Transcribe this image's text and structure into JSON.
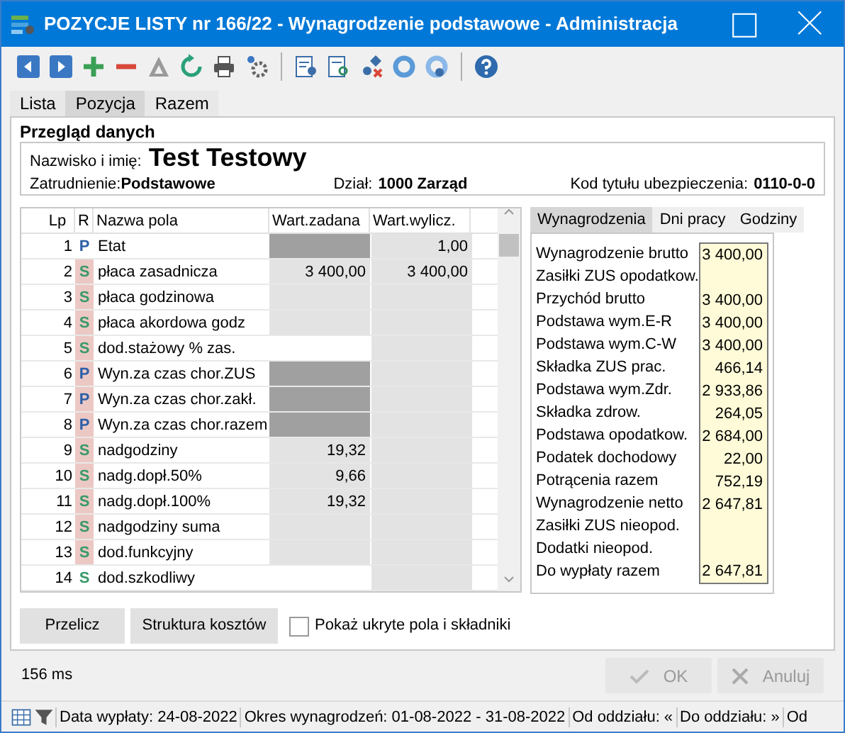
{
  "window": {
    "title": "POZYCJE LISTY nr 166/22 - Wynagrodzenie podstawowe - Administracja"
  },
  "tabs": [
    {
      "label": "Lista",
      "selected": false
    },
    {
      "label": "Pozycja",
      "selected": true
    },
    {
      "label": "Razem",
      "selected": false
    }
  ],
  "overview": {
    "title": "Przegląd danych",
    "name_label": "Nazwisko i imię:",
    "name": "Test Testowy",
    "employment_label": "Zatrudnienie:",
    "employment": "Podstawowe",
    "department_label": "Dział:",
    "department": "1000 Zarząd",
    "insurance_label": "Kod tytułu ubezpieczenia:",
    "insurance": "0110-0-0"
  },
  "table": {
    "columns": [
      "Lp",
      "R",
      "Nazwa pola",
      "Wart.zadana",
      "Wart.wylicz."
    ],
    "rows": [
      {
        "lp": "1",
        "r": "P",
        "highlighted": false,
        "name": "Etat",
        "kind": "locked",
        "calc_value": "1,00"
      },
      {
        "lp": "2",
        "r": "S",
        "highlighted": true,
        "name": "płaca zasadnicza",
        "set_value": "3 400,00",
        "kind": "readonly",
        "calc_value": "3 400,00"
      },
      {
        "lp": "3",
        "r": "S",
        "highlighted": true,
        "name": "płaca godzinowa",
        "kind": "readonly"
      },
      {
        "lp": "4",
        "r": "S",
        "highlighted": true,
        "name": "płaca akordowa godz",
        "kind": "readonly"
      },
      {
        "lp": "5",
        "r": "S",
        "highlighted": true,
        "name": "dod.stażowy % zas.",
        "kind": "editable"
      },
      {
        "lp": "6",
        "r": "P",
        "highlighted": true,
        "name": "Wyn.za czas chor.ZUS",
        "kind": "locked"
      },
      {
        "lp": "7",
        "r": "P",
        "highlighted": true,
        "name": "Wyn.za czas chor.zakł.",
        "kind": "locked"
      },
      {
        "lp": "8",
        "r": "P",
        "highlighted": true,
        "name": "Wyn.za czas chor.razem",
        "kind": "locked"
      },
      {
        "lp": "9",
        "r": "S",
        "highlighted": true,
        "name": "nadgodziny",
        "set_value": "19,32",
        "kind": "readonly"
      },
      {
        "lp": "10",
        "r": "S",
        "highlighted": true,
        "name": "nadg.dopł.50%",
        "set_value": "9,66",
        "kind": "readonly"
      },
      {
        "lp": "11",
        "r": "S",
        "highlighted": true,
        "name": "nadg.dopł.100%",
        "set_value": "19,32",
        "kind": "readonly"
      },
      {
        "lp": "12",
        "r": "S",
        "highlighted": true,
        "name": "nadgodziny suma",
        "kind": "readonly"
      },
      {
        "lp": "13",
        "r": "S",
        "highlighted": true,
        "name": "dod.funkcyjny",
        "kind": "readonly"
      },
      {
        "lp": "14",
        "r": "S",
        "highlighted": false,
        "name": "dod.szkodliwy",
        "kind": "editable"
      }
    ]
  },
  "side_tabs": [
    {
      "label": "Wynagrodzenia",
      "selected": true
    },
    {
      "label": "Dni pracy",
      "selected": false
    },
    {
      "label": "Godziny",
      "selected": false
    }
  ],
  "summary": [
    {
      "label": "Wynagrodzenie brutto",
      "value": "3 400,00"
    },
    {
      "label": "Zasiłki ZUS opodatkow."
    },
    {
      "label": "Przychód brutto",
      "value": "3 400,00"
    },
    {
      "label": "Podstawa wym.E-R",
      "value": "3 400,00"
    },
    {
      "label": "Podstawa wym.C-W",
      "value": "3 400,00"
    },
    {
      "label": "Składka ZUS prac.",
      "value": "466,14"
    },
    {
      "label": "Podstawa wym.Zdr.",
      "value": "2 933,86"
    },
    {
      "label": "Składka zdrow.",
      "value": "264,05"
    },
    {
      "label": "Podstawa opodatkow.",
      "value": "2 684,00"
    },
    {
      "label": "Podatek dochodowy",
      "value": "22,00"
    },
    {
      "label": "Potrącenia razem",
      "value": "752,19"
    },
    {
      "label": "Wynagrodzenie netto",
      "value": "2 647,81"
    },
    {
      "label": "Zasiłki ZUS nieopod."
    },
    {
      "label": "Dodatki nieopod."
    },
    {
      "label": "Do wypłaty razem",
      "value": "2 647,81"
    }
  ],
  "actions": {
    "recalc": "Przelicz",
    "cost_structure": "Struktura kosztów",
    "show_hidden": {
      "label": "Pokaż ukryte pola i składniki",
      "checked": false
    }
  },
  "timing": "156 ms",
  "dialog_buttons": [
    {
      "label": "OK",
      "kind": "ok",
      "disabled": true
    },
    {
      "label": "Anuluj",
      "kind": "cancel",
      "disabled": true
    }
  ],
  "status_bar": [
    "Data wypłaty: 24-08-2022",
    "Okres wynagrodzeń: 01-08-2022 - 31-08-2022",
    "Od oddziału: «",
    "Do oddziału: »",
    "Od"
  ]
}
